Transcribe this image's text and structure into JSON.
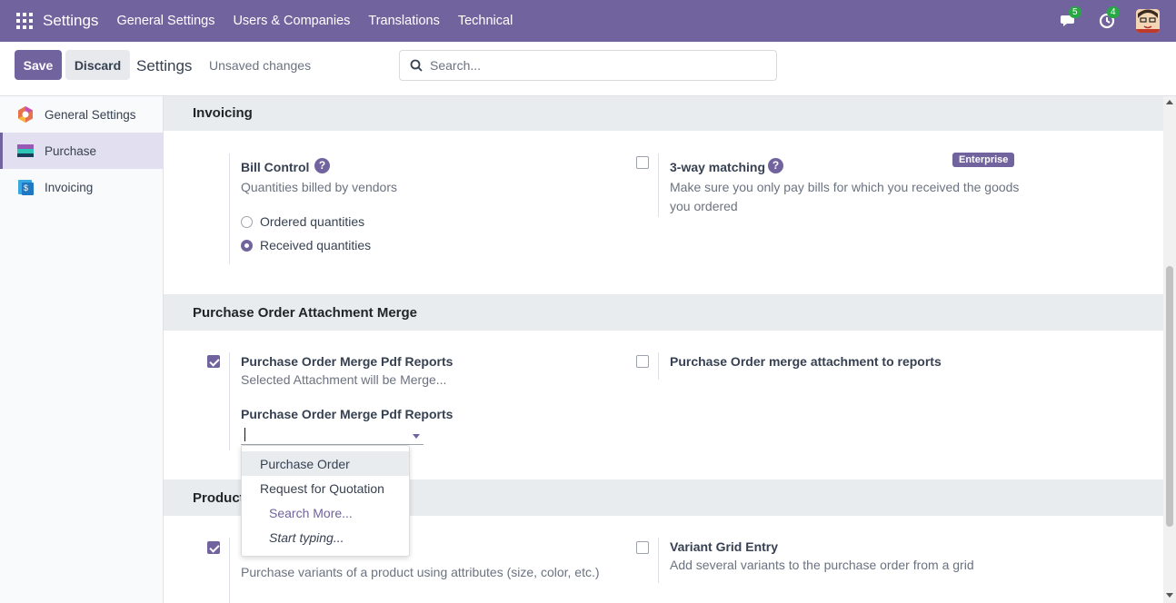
{
  "navbar": {
    "brand": "Settings",
    "menus": [
      "General Settings",
      "Users & Companies",
      "Translations",
      "Technical"
    ],
    "messages_count": "5",
    "activities_count": "4"
  },
  "control_panel": {
    "save_label": "Save",
    "discard_label": "Discard",
    "title": "Settings",
    "status": "Unsaved changes",
    "search_placeholder": "Search..."
  },
  "sidebar": {
    "items": [
      {
        "label": "General Settings",
        "icon": "general-settings-icon",
        "active": false
      },
      {
        "label": "Purchase",
        "icon": "purchase-app-icon",
        "active": true
      },
      {
        "label": "Invoicing",
        "icon": "invoicing-app-icon",
        "active": false
      }
    ]
  },
  "sections": {
    "invoicing": {
      "title": "Invoicing",
      "bill_control": {
        "label": "Bill Control",
        "description": "Quantities billed by vendors",
        "options": [
          "Ordered quantities",
          "Received quantities"
        ],
        "selected": "Received quantities"
      },
      "three_way": {
        "label": "3-way matching",
        "badge": "Enterprise",
        "description": "Make sure you only pay bills for which you received the goods you ordered",
        "checked": false
      }
    },
    "attachment_merge": {
      "title": "Purchase Order Attachment Merge",
      "merge_pdf": {
        "label": "Purchase Order Merge Pdf Reports",
        "description": "Selected Attachment will be Merge...",
        "field_label": "Purchase Order Merge Pdf Reports",
        "field_value": "",
        "checked": true
      },
      "merge_attachment": {
        "label": "Purchase Order merge attachment to reports",
        "checked": false
      }
    },
    "products": {
      "title": "Product",
      "variants": {
        "description": "Purchase variants of a product using attributes (size, color, etc.)",
        "checked": true
      },
      "variant_grid": {
        "label": "Variant Grid Entry",
        "description": "Add several variants to the purchase order from a grid",
        "checked": false
      }
    }
  },
  "dropdown": {
    "items": [
      "Purchase Order",
      "Request for Quotation"
    ],
    "search_more": "Search More...",
    "start_typing": "Start typing..."
  },
  "colors": {
    "brand": "#71639e",
    "badge_green": "#28a745"
  }
}
